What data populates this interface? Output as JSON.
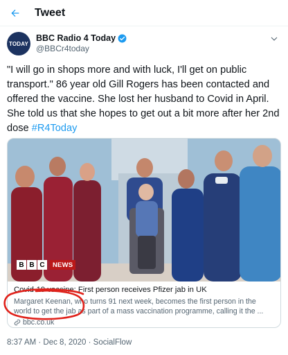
{
  "topbar": {
    "title": "Tweet"
  },
  "author": {
    "display_name": "BBC Radio 4 Today",
    "handle": "@BBCr4today",
    "avatar_text": "TODAY"
  },
  "tweet": {
    "text": "\"I will go in shops more and with luck, I'll get on public transport.\" 86 year old Gill Rogers has been contacted and offered the vaccine. She lost her husband to Covid in April. She told us that she hopes to get out a bit more after her 2nd dose",
    "hashtag": "#R4Today"
  },
  "card": {
    "logo_bbc": [
      "B",
      "B",
      "C"
    ],
    "logo_news": "NEWS",
    "title": "Covid-19 vaccine: First person receives Pfizer jab in UK",
    "description": "Margaret Keenan, who turns 91 next week, becomes the first person in the world to get the jab as part of a mass vaccination programme, calling it the ...",
    "domain": "bbc.co.uk"
  },
  "footer": {
    "meta": "8:37 AM · Dec 8, 2020 · SocialFlow"
  },
  "colors": {
    "accent": "#1d9bf0",
    "annotation": "#e0211a",
    "bbc_red": "#bb1919"
  }
}
